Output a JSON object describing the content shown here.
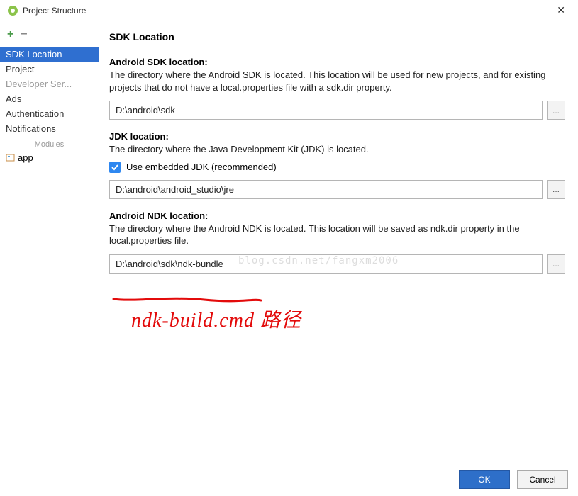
{
  "window": {
    "title": "Project Structure"
  },
  "sidebar": {
    "items": [
      {
        "label": "SDK Location",
        "selected": true
      },
      {
        "label": "Project"
      },
      {
        "label": "Developer Ser...",
        "greyed": true
      },
      {
        "label": "Ads"
      },
      {
        "label": "Authentication"
      },
      {
        "label": "Notifications"
      }
    ],
    "modules_header": "Modules",
    "modules": [
      {
        "label": "app"
      }
    ]
  },
  "main": {
    "title": "SDK Location",
    "sdk": {
      "label": "Android SDK location:",
      "desc": "The directory where the Android SDK is located. This location will be used for new projects, and for existing projects that do not have a local.properties file with a sdk.dir property.",
      "value": "D:\\android\\sdk"
    },
    "jdk": {
      "label": "JDK location:",
      "desc": "The directory where the Java Development Kit (JDK) is located.",
      "checkbox_label": "Use embedded JDK (recommended)",
      "checked": true,
      "value": "D:\\android\\android_studio\\jre"
    },
    "ndk": {
      "label": "Android NDK location:",
      "desc": "The directory where the Android NDK is located. This location will be saved as ndk.dir property in the local.properties file.",
      "value": "D:\\android\\sdk\\ndk-bundle"
    },
    "browse_label": "..."
  },
  "footer": {
    "ok": "OK",
    "cancel": "Cancel"
  },
  "annotation": {
    "text": "ndk-build.cmd  路径"
  },
  "watermark": "blog.csdn.net/fangxm2006"
}
